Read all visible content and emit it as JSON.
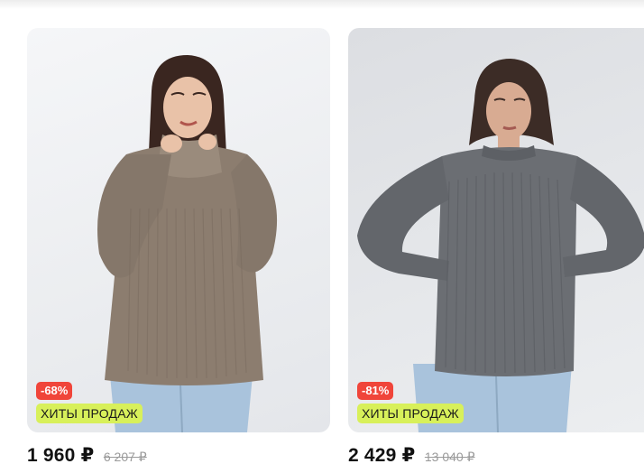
{
  "products": [
    {
      "discount": "-68%",
      "tag": "ХИТЫ ПРОДАЖ",
      "price": "1 960 ₽",
      "old_price": "6 207 ₽"
    },
    {
      "discount": "-81%",
      "tag": "ХИТЫ ПРОДАЖ",
      "price": "2 429 ₽",
      "old_price": "13 040 ₽"
    }
  ],
  "colors": {
    "discount_badge": "#f0453a",
    "hits_badge": "#d8f05a",
    "sweater_1": "#8c7d6f",
    "sweater_2": "#6b6e73",
    "jeans": "#a9c3dc"
  }
}
